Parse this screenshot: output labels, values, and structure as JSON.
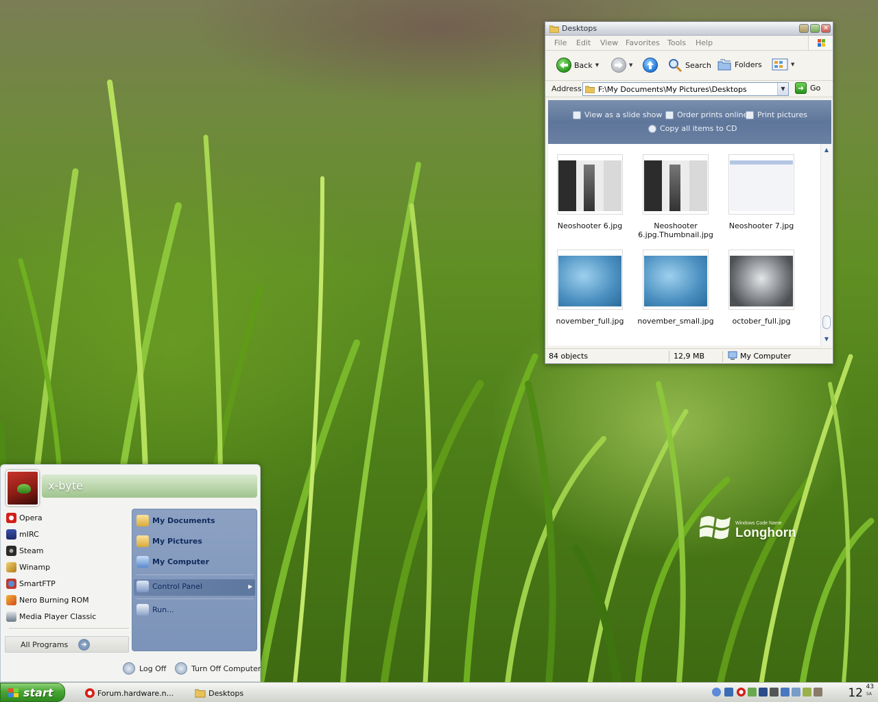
{
  "explorer": {
    "title": "Desktops",
    "menu": [
      "File",
      "Edit",
      "View",
      "Favorites",
      "Tools",
      "Help"
    ],
    "toolbar": {
      "back": "Back",
      "search": "Search",
      "folders": "Folders"
    },
    "address": {
      "label": "Address",
      "value": "F:\\My Documents\\My Pictures\\Desktops",
      "go": "Go"
    },
    "tasks": {
      "slideshow": "View as a slide show",
      "order_prints": "Order prints online",
      "print": "Print pictures",
      "copy_cd": "Copy all items to CD"
    },
    "files": [
      {
        "name": "Neoshooter 6.jpg",
        "thumb": "neo"
      },
      {
        "name": "Neoshooter 6.jpg.Thumbnail.jpg",
        "thumb": "neo"
      },
      {
        "name": "Neoshooter 7.jpg",
        "thumb": "neo7"
      },
      {
        "name": "november_full.jpg",
        "thumb": "nov"
      },
      {
        "name": "november_small.jpg",
        "thumb": "nov"
      },
      {
        "name": "october_full.jpg",
        "thumb": "oct"
      }
    ],
    "status": {
      "objects": "84 objects",
      "size": "12,9 MB",
      "location": "My Computer"
    }
  },
  "start_menu": {
    "user": "x-byte",
    "programs": [
      {
        "label": "Opera",
        "icon": "opera-icon",
        "color": "#d3201a"
      },
      {
        "label": "mIRC",
        "icon": "mirc-icon",
        "color": "#2c3a8a"
      },
      {
        "label": "Steam",
        "icon": "steam-icon",
        "color": "#2b2b2b"
      },
      {
        "label": "Winamp",
        "icon": "winamp-icon",
        "color": "#c79a2a"
      },
      {
        "label": "SmartFTP",
        "icon": "smartftp-icon",
        "color": "#c0392b"
      },
      {
        "label": "Nero Burning ROM",
        "icon": "nero-icon",
        "color": "#e07a1f"
      },
      {
        "label": "Media Player Classic",
        "icon": "media-player-icon",
        "color": "#5a6a7a"
      }
    ],
    "all_programs": "All Programs",
    "places": {
      "my_documents": "My Documents",
      "my_pictures": "My Pictures",
      "my_computer": "My Computer",
      "control_panel": "Control Panel",
      "run": "Run..."
    },
    "log_off": "Log Off",
    "turn_off": "Turn Off Computer"
  },
  "taskbar": {
    "start": "start",
    "buttons": [
      {
        "label": "Forum.hardware.n...",
        "icon": "opera-icon"
      },
      {
        "label": "Desktops",
        "icon": "folder-icon"
      }
    ],
    "clock": {
      "hour": "12",
      "minute": "43",
      "suffix": "SA"
    }
  },
  "desktop": {
    "logo_small": "Windows Code Name",
    "logo_big": "Longhorn"
  }
}
